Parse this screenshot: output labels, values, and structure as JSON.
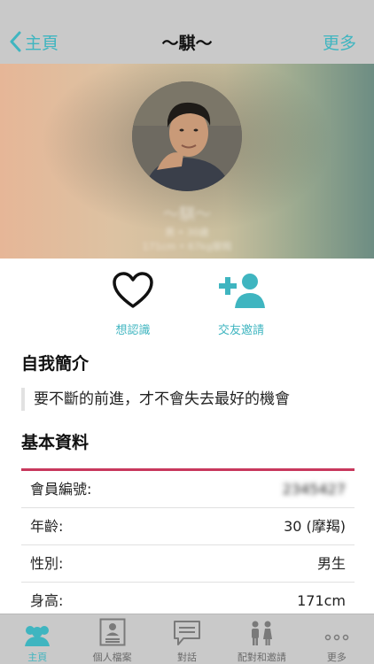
{
  "nav": {
    "back_label": "主頁",
    "title": "～騏～",
    "more_label": "更多"
  },
  "hero": {
    "name_blur": "～騏～",
    "line1_blur": "男 • 30歲",
    "line2_blur": "171cm • 67kg摩羯"
  },
  "actions": [
    {
      "label": "想認識",
      "icon": "heart-icon"
    },
    {
      "label": "交友邀請",
      "icon": "add-friend-icon"
    }
  ],
  "intro": {
    "title": "自我簡介",
    "text": "要不斷的前進，才不會失去最好的機會"
  },
  "basic": {
    "title": "基本資料",
    "rows": [
      {
        "key": "會員編號:",
        "value": "2345427"
      },
      {
        "key": "年齡:",
        "value": "30 (摩羯)"
      },
      {
        "key": "性別:",
        "value": "男生"
      },
      {
        "key": "身高:",
        "value": "171cm"
      }
    ]
  },
  "tabs": [
    {
      "label": "主頁",
      "icon": "people-icon",
      "active": true
    },
    {
      "label": "個人檔案",
      "icon": "profile-card-icon"
    },
    {
      "label": "對話",
      "icon": "chat-icon"
    },
    {
      "label": "配對和邀請",
      "icon": "couple-icon"
    },
    {
      "label": "更多",
      "icon": "more-dots-icon"
    }
  ],
  "colors": {
    "accent": "#3fb5c0",
    "divider": "#c8385c",
    "bars": "#c9c9c9"
  }
}
